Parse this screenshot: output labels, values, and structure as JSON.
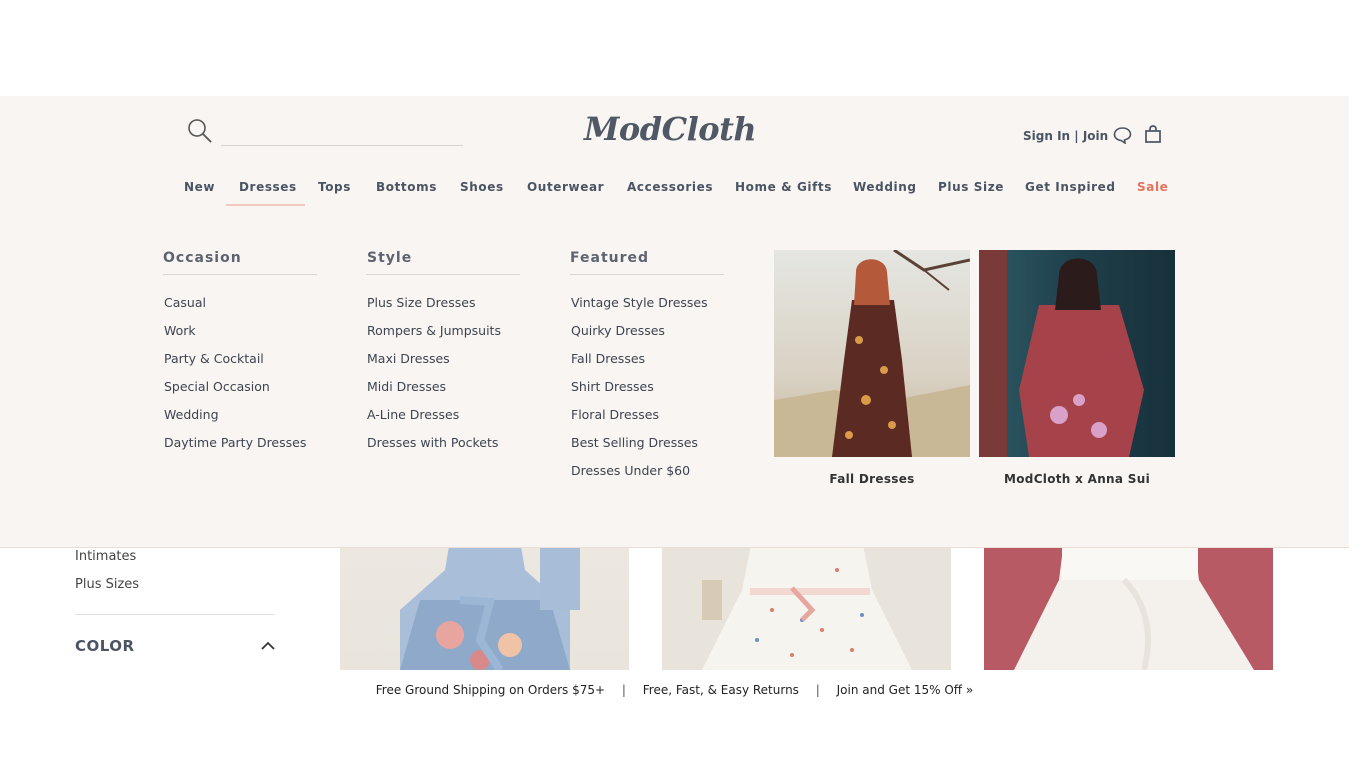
{
  "sidebar": {
    "items": [
      "Intimates",
      "Plus Sizes"
    ],
    "color_label": "COLOR"
  },
  "shipping": {
    "free_shipping": "Free Ground Shipping on Orders $75+",
    "returns": "Free, Fast, & Easy Returns",
    "join_offer": "Join and Get 15% Off »",
    "separator": "|"
  },
  "header": {
    "logo": "ModCloth",
    "search_placeholder": "",
    "account_text": "Sign In | Join"
  },
  "nav": {
    "items": [
      "New",
      "Dresses",
      "Tops",
      "Bottoms",
      "Shoes",
      "Outerwear",
      "Accessories",
      "Home & Gifts",
      "Wedding",
      "Plus Size",
      "Get Inspired",
      "Sale"
    ],
    "active": "Dresses",
    "sale_color": "#e2735f"
  },
  "mega_menu": {
    "occasion": {
      "title": "Occasion",
      "links": [
        "Casual",
        "Work",
        "Party & Cocktail",
        "Special Occasion",
        "Wedding",
        "Daytime Party Dresses"
      ]
    },
    "style": {
      "title": "Style",
      "links": [
        "Plus Size Dresses",
        "Rompers & Jumpsuits",
        "Maxi Dresses",
        "Midi Dresses",
        "A-Line Dresses",
        "Dresses with Pockets"
      ]
    },
    "featured": {
      "title": "Featured",
      "links": [
        "Vintage Style Dresses",
        "Quirky Dresses",
        "Fall Dresses",
        "Shirt Dresses",
        "Floral Dresses",
        "Best Selling Dresses",
        "Dresses Under $60"
      ]
    },
    "promos": [
      {
        "caption": "Fall Dresses"
      },
      {
        "caption": "ModCloth x Anna Sui"
      }
    ]
  },
  "colors": {
    "header_bg": "#f8f5f2",
    "text_primary": "#4b5463",
    "accent_underline": "#f1c9be"
  }
}
